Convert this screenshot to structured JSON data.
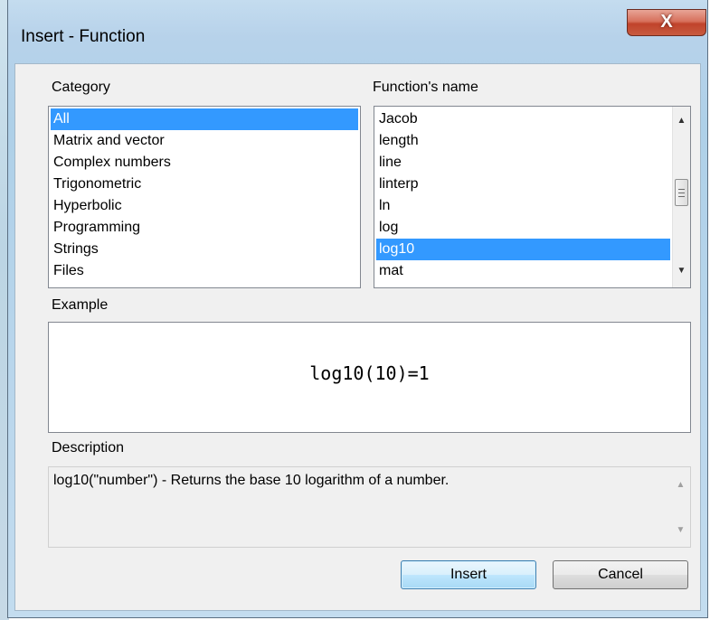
{
  "window": {
    "title": "Insert - Function",
    "close_label": "X"
  },
  "category": {
    "label": "Category",
    "items": [
      "All",
      "Matrix and vector",
      "Complex numbers",
      "Trigonometric",
      "Hyperbolic",
      "Programming",
      "Strings",
      "Files"
    ],
    "selected": "All"
  },
  "functions": {
    "label": "Function's name",
    "items": [
      "Jacob",
      "length",
      "line",
      "linterp",
      "ln",
      "log",
      "log10",
      "mat"
    ],
    "selected": "log10"
  },
  "example": {
    "label": "Example",
    "formula": "log10(10)=1"
  },
  "description": {
    "label": "Description",
    "text": "log10(\"number\") - Returns the base 10 logarithm of a number."
  },
  "buttons": {
    "insert_label": "Insert",
    "cancel_label": "Cancel"
  },
  "colors": {
    "selection": "#3399ff",
    "close_button": "#c8432b",
    "frame": "#b7d2ea"
  }
}
